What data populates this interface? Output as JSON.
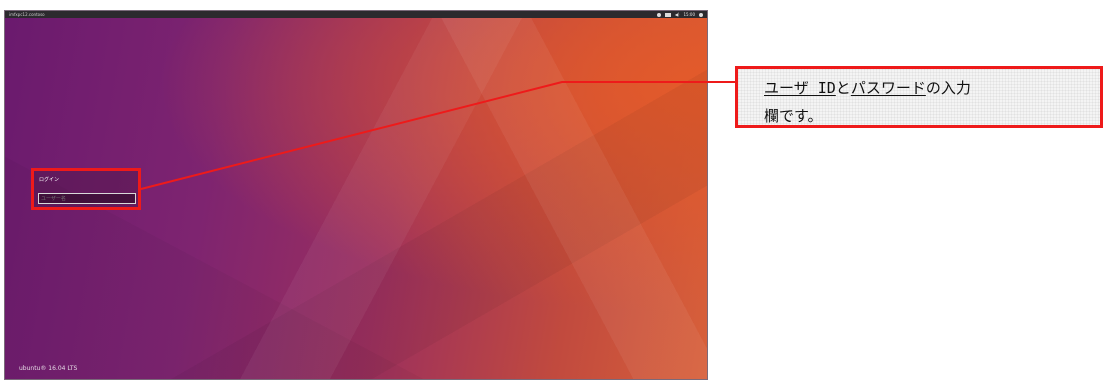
{
  "screen": {
    "topbar_title": "imfxpc12.contoso",
    "clock": "15:00",
    "login_label": "ログイン",
    "username_placeholder": "ユーザー名",
    "brand": "ubuntu® 16.04 LTS",
    "icons": [
      "network-icon",
      "keyboard-icon",
      "volume-icon",
      "power-icon"
    ]
  },
  "callout": {
    "part1": "ユーザ ID",
    "part2": "と",
    "part3": "パスワード",
    "part4": "の入力",
    "line2": "欄です。"
  },
  "colors": {
    "callout_red": "#ee1a1a",
    "wallpaper_purple": "#7e2470",
    "wallpaper_orange": "#e35a2a"
  }
}
